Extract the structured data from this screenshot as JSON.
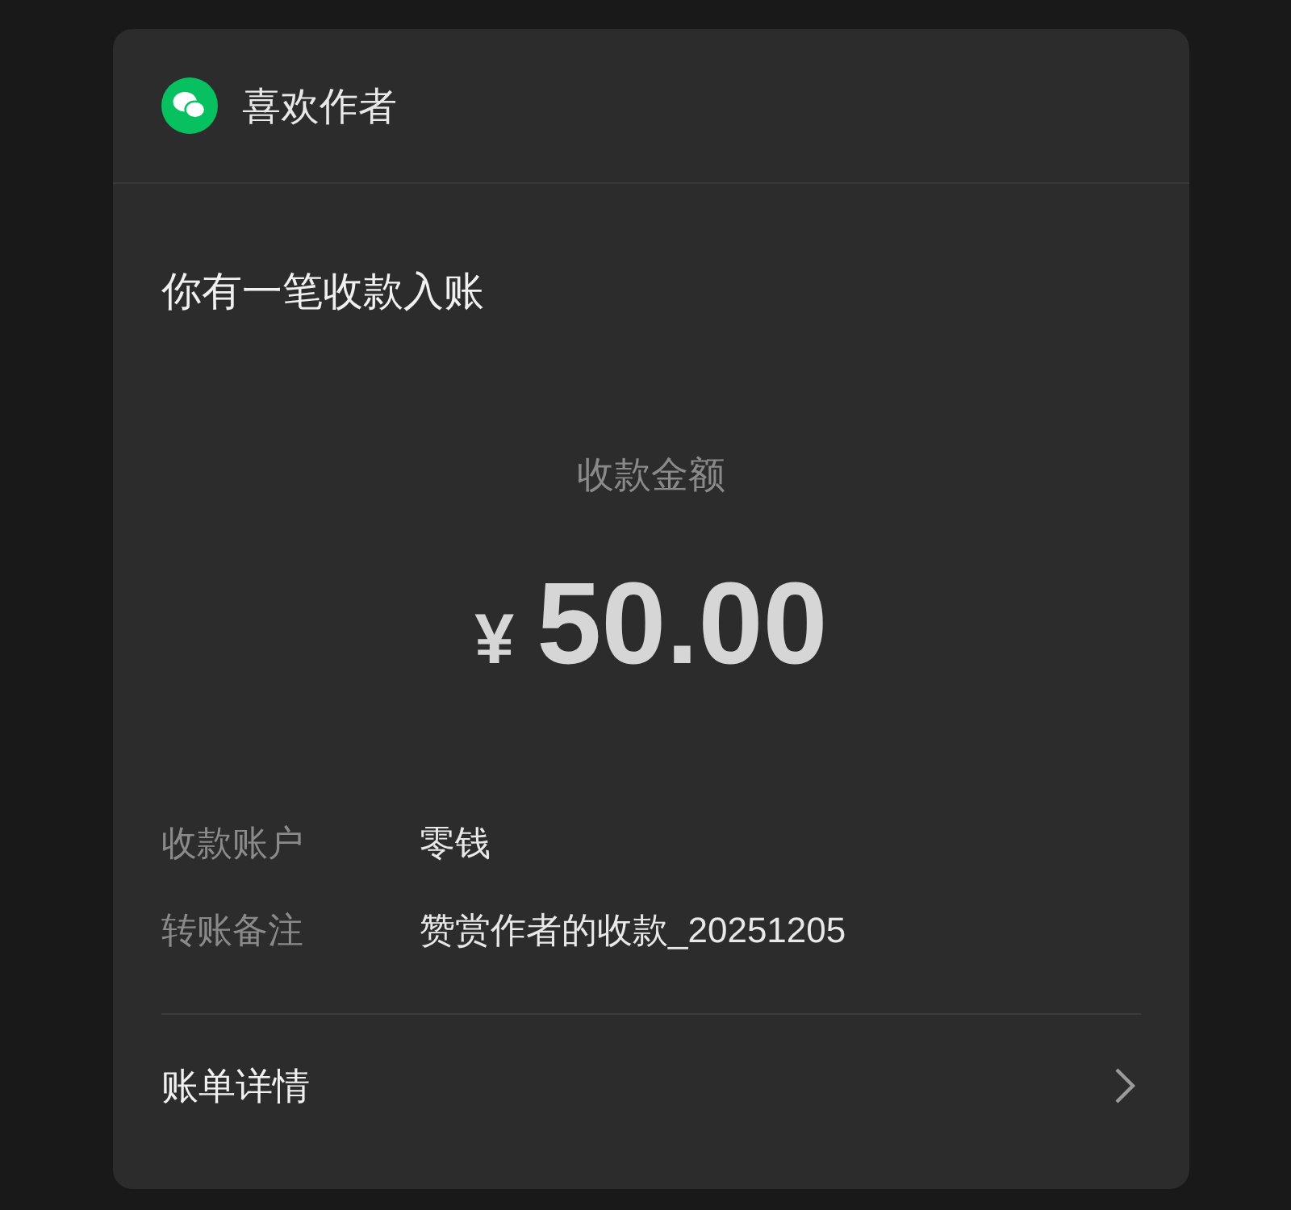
{
  "header": {
    "title": "喜欢作者"
  },
  "message": {
    "title": "你有一笔收款入账"
  },
  "amount": {
    "label": "收款金额",
    "currency": "¥",
    "value": "50.00"
  },
  "details": [
    {
      "label": "收款账户",
      "value": "零钱"
    },
    {
      "label": "转账备注",
      "value": "赞赏作者的收款_20251205"
    }
  ],
  "footer": {
    "link": "账单详情"
  }
}
